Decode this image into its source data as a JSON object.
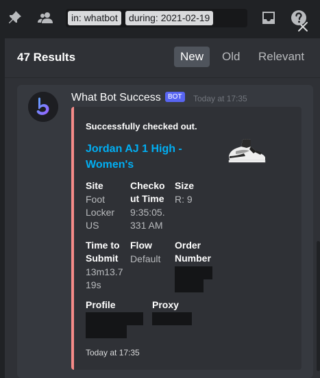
{
  "toolbar": {
    "search_chips": [
      {
        "prefix": "in:",
        "value": "whatbot"
      },
      {
        "prefix": "during:",
        "value": "2021-02-19"
      }
    ],
    "icons": [
      "pin-icon",
      "members-icon",
      "clear-icon",
      "inbox-icon",
      "help-icon"
    ]
  },
  "results": {
    "count_label": "47 Results",
    "sort_tabs": [
      "New",
      "Old",
      "Relevant"
    ],
    "active_sort": "New"
  },
  "message": {
    "author": "What Bot Success",
    "badge": "BOT",
    "timestamp": "Today at 17:35",
    "embed": {
      "accent_color": "#f58a88",
      "description": "Successfully checked out.",
      "title": "Jordan AJ 1 High - Women's",
      "fields": {
        "site": {
          "name": "Site",
          "value": "Foot Locker US"
        },
        "checkout_time": {
          "name": "Checkout Time",
          "value": "9:35:05.331 AM"
        },
        "size": {
          "name": "Size",
          "value": "R: 9"
        },
        "time_to_submit": {
          "name": "Time to Submit",
          "value": "13m13.719s"
        },
        "flow": {
          "name": "Flow",
          "value": "Default"
        },
        "order_number": {
          "name": "Order Number",
          "value": ""
        },
        "profile": {
          "name": "Profile",
          "value": ""
        },
        "proxy": {
          "name": "Proxy",
          "value": ""
        }
      },
      "footer": "Today at 17:35"
    }
  },
  "colors": {
    "background": "#202225",
    "panel": "#2f3136",
    "card": "#36393f",
    "link": "#00aff4",
    "bot_badge": "#5865f2"
  }
}
